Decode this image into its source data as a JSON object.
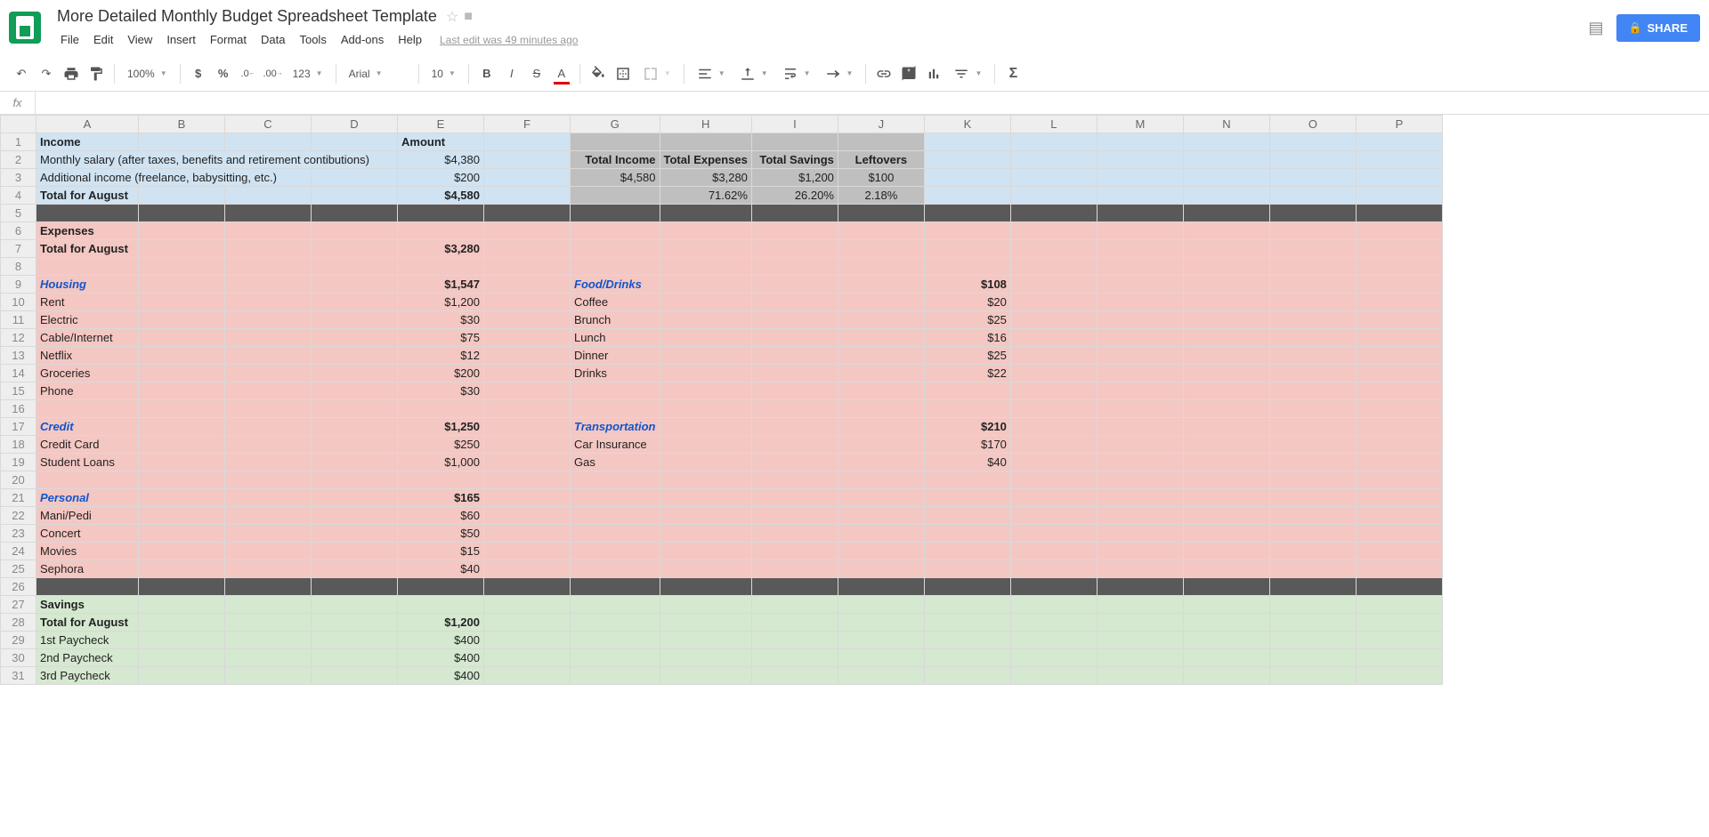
{
  "doc": {
    "title": "More Detailed Monthly Budget Spreadsheet Template",
    "last_edit": "Last edit was 49 minutes ago"
  },
  "menus": [
    "File",
    "Edit",
    "View",
    "Insert",
    "Format",
    "Data",
    "Tools",
    "Add-ons",
    "Help"
  ],
  "share": "SHARE",
  "toolbar": {
    "zoom": "100%",
    "font": "Arial",
    "size": "10",
    "more_formats": "123"
  },
  "fx": "fx",
  "columns": [
    "A",
    "B",
    "C",
    "D",
    "E",
    "F",
    "G",
    "H",
    "I",
    "J",
    "K",
    "L",
    "M",
    "N",
    "O",
    "P"
  ],
  "rows": [
    {
      "n": 1,
      "style": "blue",
      "cells": {
        "A": {
          "t": "Income",
          "b": 1
        },
        "E": {
          "t": "Amount",
          "b": 1
        },
        "G": {
          "bg": "grey"
        },
        "H": {
          "bg": "grey"
        },
        "I": {
          "bg": "grey"
        },
        "J": {
          "bg": "grey"
        }
      }
    },
    {
      "n": 2,
      "style": "blue",
      "cells": {
        "A": {
          "t": "Monthly salary (after taxes, benefits and retirement contibutions)",
          "span": 4
        },
        "E": {
          "t": "$4,380",
          "r": 1
        },
        "G": {
          "t": "Total Income",
          "b": 1,
          "bg": "grey",
          "r": 1
        },
        "H": {
          "t": "Total Expenses",
          "b": 1,
          "bg": "grey",
          "r": 1
        },
        "I": {
          "t": "Total Savings",
          "b": 1,
          "bg": "grey",
          "r": 1
        },
        "J": {
          "t": "Leftovers",
          "b": 1,
          "bg": "grey",
          "c": 1
        }
      }
    },
    {
      "n": 3,
      "style": "blue",
      "cells": {
        "A": {
          "t": "Additional income (freelance, babysitting, etc.)",
          "span": 3
        },
        "E": {
          "t": "$200",
          "r": 1
        },
        "G": {
          "t": "$4,580",
          "bg": "grey",
          "r": 1
        },
        "H": {
          "t": "$3,280",
          "bg": "grey",
          "r": 1
        },
        "I": {
          "t": "$1,200",
          "bg": "grey",
          "r": 1
        },
        "J": {
          "t": "$100",
          "bg": "grey",
          "c": 1
        }
      }
    },
    {
      "n": 4,
      "style": "blue",
      "cells": {
        "A": {
          "t": "Total for August",
          "b": 1
        },
        "E": {
          "t": "$4,580",
          "b": 1,
          "r": 1
        },
        "G": {
          "bg": "grey"
        },
        "H": {
          "t": "71.62%",
          "bg": "grey",
          "r": 1
        },
        "I": {
          "t": "26.20%",
          "bg": "grey",
          "r": 1
        },
        "J": {
          "t": "2.18%",
          "bg": "grey",
          "c": 1
        }
      }
    },
    {
      "n": 5,
      "style": "dark",
      "cells": {}
    },
    {
      "n": 6,
      "style": "pink",
      "cells": {
        "A": {
          "t": "Expenses",
          "b": 1
        }
      }
    },
    {
      "n": 7,
      "style": "pink",
      "cells": {
        "A": {
          "t": "Total for August",
          "b": 1
        },
        "E": {
          "t": "$3,280",
          "b": 1,
          "r": 1
        }
      }
    },
    {
      "n": 8,
      "style": "pink",
      "cells": {}
    },
    {
      "n": 9,
      "style": "pink",
      "cells": {
        "A": {
          "t": "Housing",
          "b": 1,
          "i": 1,
          "lc": 1
        },
        "E": {
          "t": "$1,547",
          "b": 1,
          "r": 1
        },
        "G": {
          "t": "Food/Drinks",
          "b": 1,
          "i": 1,
          "lc": 1
        },
        "K": {
          "t": "$108",
          "b": 1,
          "r": 1
        }
      }
    },
    {
      "n": 10,
      "style": "pink",
      "cells": {
        "A": {
          "t": "Rent"
        },
        "E": {
          "t": "$1,200",
          "r": 1
        },
        "G": {
          "t": "Coffee"
        },
        "K": {
          "t": "$20",
          "r": 1
        }
      }
    },
    {
      "n": 11,
      "style": "pink",
      "cells": {
        "A": {
          "t": "Electric"
        },
        "E": {
          "t": "$30",
          "r": 1
        },
        "G": {
          "t": "Brunch"
        },
        "K": {
          "t": "$25",
          "r": 1
        }
      }
    },
    {
      "n": 12,
      "style": "pink",
      "cells": {
        "A": {
          "t": "Cable/Internet"
        },
        "E": {
          "t": "$75",
          "r": 1
        },
        "G": {
          "t": "Lunch"
        },
        "K": {
          "t": "$16",
          "r": 1
        }
      }
    },
    {
      "n": 13,
      "style": "pink",
      "cells": {
        "A": {
          "t": "Netflix"
        },
        "E": {
          "t": "$12",
          "r": 1
        },
        "G": {
          "t": "Dinner"
        },
        "K": {
          "t": "$25",
          "r": 1
        }
      }
    },
    {
      "n": 14,
      "style": "pink",
      "cells": {
        "A": {
          "t": "Groceries"
        },
        "E": {
          "t": "$200",
          "r": 1
        },
        "G": {
          "t": "Drinks"
        },
        "K": {
          "t": "$22",
          "r": 1
        }
      }
    },
    {
      "n": 15,
      "style": "pink",
      "cells": {
        "A": {
          "t": "Phone"
        },
        "E": {
          "t": "$30",
          "r": 1
        }
      }
    },
    {
      "n": 16,
      "style": "pink",
      "cells": {}
    },
    {
      "n": 17,
      "style": "pink",
      "cells": {
        "A": {
          "t": "Credit",
          "b": 1,
          "i": 1,
          "lc": 1
        },
        "E": {
          "t": "$1,250",
          "b": 1,
          "r": 1
        },
        "G": {
          "t": "Transportation",
          "b": 1,
          "i": 1,
          "lc": 1
        },
        "K": {
          "t": "$210",
          "b": 1,
          "r": 1
        }
      }
    },
    {
      "n": 18,
      "style": "pink",
      "cells": {
        "A": {
          "t": "Credit Card"
        },
        "E": {
          "t": "$250",
          "r": 1
        },
        "G": {
          "t": "Car Insurance"
        },
        "K": {
          "t": "$170",
          "r": 1
        }
      }
    },
    {
      "n": 19,
      "style": "pink",
      "cells": {
        "A": {
          "t": "Student Loans"
        },
        "E": {
          "t": "$1,000",
          "r": 1
        },
        "G": {
          "t": "Gas"
        },
        "K": {
          "t": "$40",
          "r": 1
        }
      }
    },
    {
      "n": 20,
      "style": "pink",
      "cells": {}
    },
    {
      "n": 21,
      "style": "pink",
      "cells": {
        "A": {
          "t": "Personal",
          "b": 1,
          "i": 1,
          "lc": 1
        },
        "E": {
          "t": "$165",
          "b": 1,
          "r": 1
        }
      }
    },
    {
      "n": 22,
      "style": "pink",
      "cells": {
        "A": {
          "t": "Mani/Pedi"
        },
        "E": {
          "t": "$60",
          "r": 1
        }
      }
    },
    {
      "n": 23,
      "style": "pink",
      "cells": {
        "A": {
          "t": "Concert"
        },
        "E": {
          "t": "$50",
          "r": 1
        }
      }
    },
    {
      "n": 24,
      "style": "pink",
      "cells": {
        "A": {
          "t": "Movies"
        },
        "E": {
          "t": "$15",
          "r": 1
        }
      }
    },
    {
      "n": 25,
      "style": "pink",
      "cells": {
        "A": {
          "t": "Sephora"
        },
        "E": {
          "t": "$40",
          "r": 1
        }
      }
    },
    {
      "n": 26,
      "style": "dark",
      "cells": {}
    },
    {
      "n": 27,
      "style": "green",
      "cells": {
        "A": {
          "t": "Savings",
          "b": 1
        }
      }
    },
    {
      "n": 28,
      "style": "green",
      "cells": {
        "A": {
          "t": "Total for August",
          "b": 1
        },
        "E": {
          "t": "$1,200",
          "b": 1,
          "r": 1
        }
      }
    },
    {
      "n": 29,
      "style": "green",
      "cells": {
        "A": {
          "t": "1st Paycheck"
        },
        "E": {
          "t": "$400",
          "r": 1
        }
      }
    },
    {
      "n": 30,
      "style": "green",
      "cells": {
        "A": {
          "t": "2nd Paycheck"
        },
        "E": {
          "t": "$400",
          "r": 1
        }
      }
    },
    {
      "n": 31,
      "style": "green",
      "cells": {
        "A": {
          "t": "3rd Paycheck"
        },
        "E": {
          "t": "$400",
          "r": 1
        }
      }
    }
  ]
}
